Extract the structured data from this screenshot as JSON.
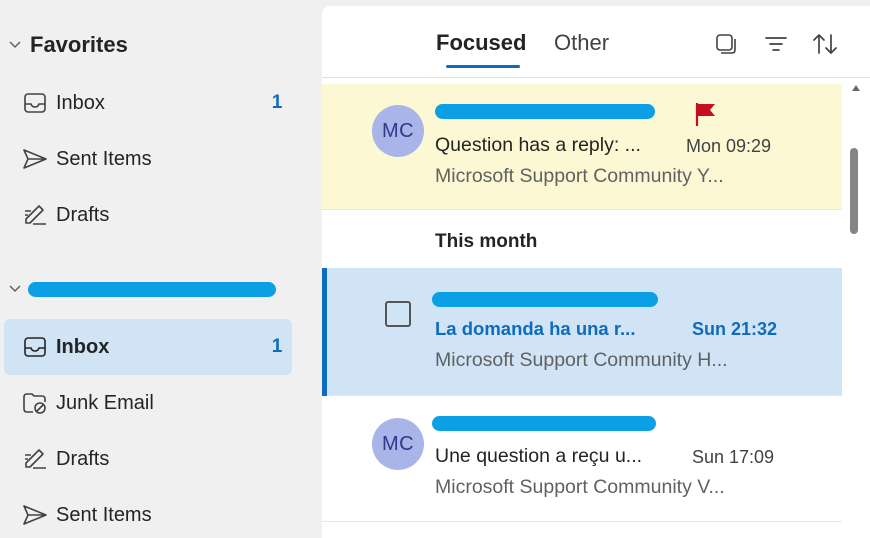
{
  "sidebar": {
    "favorites_title": "Favorites",
    "favorites": [
      {
        "label": "Inbox",
        "count": "1",
        "icon": "inbox-icon"
      },
      {
        "label": "Sent Items",
        "count": "",
        "icon": "send-icon"
      },
      {
        "label": "Drafts",
        "count": "",
        "icon": "drafts-icon"
      }
    ],
    "account_items": [
      {
        "label": "Inbox",
        "count": "1",
        "icon": "inbox-icon"
      },
      {
        "label": "Junk Email",
        "count": "",
        "icon": "junk-icon"
      },
      {
        "label": "Drafts",
        "count": "",
        "icon": "drafts-icon"
      },
      {
        "label": "Sent Items",
        "count": "",
        "icon": "send-icon"
      }
    ]
  },
  "message_list": {
    "tabs": {
      "focused": "Focused",
      "other": "Other"
    },
    "group_this_month": "This month",
    "messages": [
      {
        "avatar": "MC",
        "subject": "Question has a reply: ...",
        "time": "Mon 09:29",
        "preview": "Microsoft Support Community Y..."
      },
      {
        "avatar": "",
        "subject": "La domanda ha una r...",
        "time": "Sun 21:32",
        "preview": "Microsoft Support Community H..."
      },
      {
        "avatar": "MC",
        "subject": "Une question a reçu u...",
        "time": "Sun 17:09",
        "preview": "Microsoft Support Community V..."
      }
    ]
  },
  "colors": {
    "accent": "#0f6cbd",
    "redaction": "#0ba0e6",
    "flag": "#c50f1f",
    "selected_bg": "#d0e4f6",
    "flagged_bg": "#fcf8d4"
  }
}
